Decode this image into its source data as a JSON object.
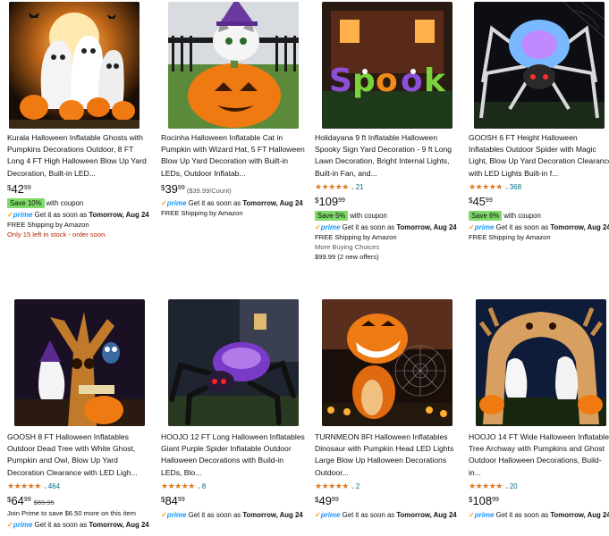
{
  "products": [
    {
      "title": "Kurala Halloween Inflatable Ghosts with Pumpkins Decorations Outdoor, 8 FT Long 4 FT High Halloween Blow Up Yard Decoration, Built-in LED...",
      "price": {
        "currency": "$",
        "whole": "42",
        "fraction": "99"
      },
      "coupon": {
        "badge": "Save 10%",
        "text": "with coupon"
      },
      "prime": {
        "label": "prime",
        "text": "Get it as soon as",
        "date": "Tomorrow, Aug 24"
      },
      "shipping": "FREE Shipping by Amazon",
      "stock": "Only 15 left in stock - order soon."
    },
    {
      "title": "Rocinha Halloween Inflatable Cat in Pumpkin with Wizard Hat, 5 FT Halloween Blow Up Yard Decoration with Built-in LEDs, Outdoor Inflatab...",
      "price": {
        "currency": "$",
        "whole": "39",
        "fraction": "99",
        "unit_price": "($39.99/Count)"
      },
      "prime": {
        "label": "prime",
        "text": "Get it as soon as",
        "date": "Tomorrow, Aug 24"
      },
      "shipping": "FREE Shipping by Amazon"
    },
    {
      "title": "Holidayana 9 ft Inflatable Halloween Spooky Sign Yard Decoration - 9 ft Long Lawn Decoration, Bright Internal Lights, Built-in Fan, and...",
      "rating": {
        "stars": "★★★★★",
        "value": 4.5,
        "count": "21"
      },
      "price": {
        "currency": "$",
        "whole": "109",
        "fraction": "99"
      },
      "coupon": {
        "badge": "Save 5%",
        "text": "with coupon"
      },
      "prime": {
        "label": "prime",
        "text": "Get it as soon as",
        "date": "Tomorrow, Aug 24"
      },
      "shipping": "FREE Shipping by Amazon",
      "more_choices": "More Buying Choices",
      "offers": "$99.99 (2 new offers)"
    },
    {
      "title": "GOOSH 6 FT Height Halloween Inflatables Outdoor Spider with Magic Light, Blow Up Yard Decoration Clearance with LED Lights Built-in f...",
      "rating": {
        "stars": "★★★★★",
        "value": 4.5,
        "count": "368"
      },
      "price": {
        "currency": "$",
        "whole": "45",
        "fraction": "99"
      },
      "coupon": {
        "badge": "Save 6%",
        "text": "with coupon"
      },
      "prime": {
        "label": "prime",
        "text": "Get it as soon as",
        "date": "Tomorrow, Aug 24"
      },
      "shipping": "FREE Shipping by Amazon"
    },
    {
      "title": "GOOSH 8 FT Halloween Inflatables Outdoor Dead Tree with White Ghost, Pumpkin and Owl, Blow Up Yard Decoration Clearance with LED Ligh...",
      "rating": {
        "stars": "★★★★★",
        "value": 4.5,
        "count": "464"
      },
      "price": {
        "currency": "$",
        "whole": "64",
        "fraction": "99",
        "was": "$69.95"
      },
      "join_prime": "Join Prime to save $6.50 more on this item",
      "prime": {
        "label": "prime",
        "text": "Get it as soon as",
        "date": "Tomorrow, Aug 24"
      }
    },
    {
      "title": "HOOJO 12 FT Long Halloween Inflatables Giant Purple Spider Inflatable Outdoor Halloween Decorations with Build-in LEDs, Blo...",
      "rating": {
        "stars": "★★★★★",
        "value": 5,
        "count": "8"
      },
      "price": {
        "currency": "$",
        "whole": "84",
        "fraction": "99"
      },
      "prime": {
        "label": "prime",
        "text": "Get it as soon as",
        "date": "Tomorrow, Aug 24"
      }
    },
    {
      "title": "TURNMEON 8Ft Halloween Inflatables Dinosaur with Pumpkin Head LED Lights Large Blow Up Halloween Decorations Outdoor...",
      "rating": {
        "stars": "★★★★★",
        "value": 3.5,
        "count": "2"
      },
      "price": {
        "currency": "$",
        "whole": "49",
        "fraction": "99"
      },
      "prime": {
        "label": "prime",
        "text": "Get it as soon as",
        "date": "Tomorrow, Aug 24"
      }
    },
    {
      "title": "HOOJO 14 FT Wide Halloween Inflatables Tree Archway with Pumpkins and Ghost Outdoor Halloween Decorations, Build-in...",
      "rating": {
        "stars": "★★★★★",
        "value": 5,
        "count": "20"
      },
      "price": {
        "currency": "$",
        "whole": "108",
        "fraction": "99"
      },
      "prime": {
        "label": "prime",
        "text": "Get it as soon as",
        "date": "Tomorrow, Aug 24"
      }
    }
  ],
  "icons": {
    "prime_check": "check-icon",
    "rating_chevron": "chevron-down-icon"
  },
  "colors": {
    "link": "#007185",
    "star": "#de7921",
    "coupon_badge": "#7fda69",
    "prime": "#1a98ff",
    "alert": "#b12704"
  }
}
